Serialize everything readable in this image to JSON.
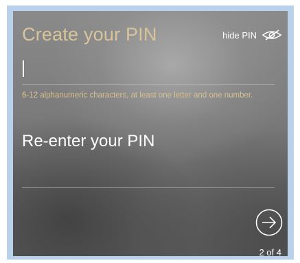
{
  "pin_screen": {
    "title": "Create your PIN",
    "hide_pin_label": "hide PIN",
    "hide_pin_icon": "eye-slash-icon",
    "pin_value": "",
    "hint": "6-12 alphanumeric characters, at least one letter and one number.",
    "reenter_label": "Re-enter your PIN",
    "reenter_value": "",
    "next_icon": "arrow-right-circle-icon",
    "step_indicator": "2 of 4"
  },
  "colors": {
    "frame": "#b9d1ea",
    "title": "#d9c49a",
    "hint": "#d7c08f",
    "text": "#ffffff"
  }
}
